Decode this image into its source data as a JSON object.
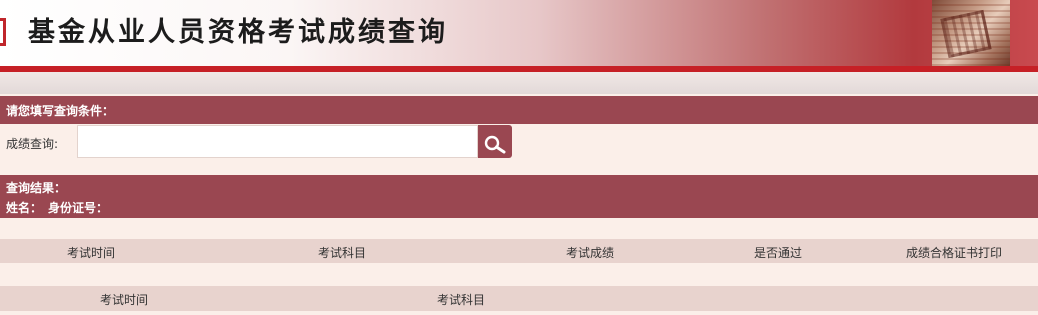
{
  "header": {
    "title": "基金从业人员资格考试成绩查询"
  },
  "query_section": {
    "heading": "请您填写查询条件：",
    "score_label": "成绩查询:",
    "input_value": "",
    "placeholder": "",
    "search_icon": "search-icon"
  },
  "result_section": {
    "heading": "查询结果：",
    "name_label": "姓名：",
    "id_label": "身份证号："
  },
  "score_table": {
    "columns": [
      "考试时间",
      "考试科目",
      "考试成绩",
      "是否通过",
      "成绩合格证书打印"
    ]
  },
  "second_table": {
    "columns": [
      "考试时间",
      "考试科目"
    ]
  },
  "colors": {
    "accent": "#9a4751",
    "banner_red": "#c62026",
    "background": "#fbefe9",
    "table_header": "#e8d3ce"
  }
}
